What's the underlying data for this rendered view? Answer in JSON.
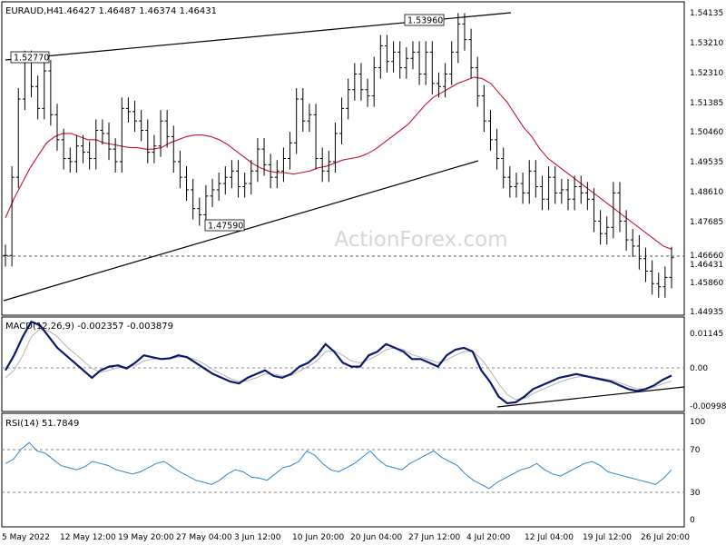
{
  "header": {
    "symbol": "EURAUD,H4",
    "ohlc": "1.46427 1.46487 1.46374 1.46431"
  },
  "watermark": "ActionForex.com",
  "colors": {
    "candles": "#000000",
    "sma": "#c8102e",
    "macd_line": "#0b1a6e",
    "macd_signal": "#b3b3b3",
    "rsi_line": "#2f86d0",
    "grid": "#9a9a9a",
    "watermark": "#d6d6d6"
  },
  "chart_data": [
    {
      "type": "candlestick",
      "title": "EURAUD,H4",
      "ohlc_label": "1.46427 1.46487 1.46374 1.46431",
      "y_ticks": [
        "1.54135",
        "1.53210",
        "1.52310",
        "1.51385",
        "1.50460",
        "1.49535",
        "1.48610",
        "1.47685",
        "1.46660",
        "1.46431",
        "1.45860",
        "1.44935"
      ],
      "current_price": 1.46431,
      "reference_level": 1.4666,
      "ylim": [
        1.4465,
        1.5455
      ],
      "x_labels": [
        "5 May 2022",
        "12 May 12:00",
        "19 May 20:00",
        "27 May 04:00",
        "3 Jun 12:00",
        "10 Jun 20:00",
        "20 Jun 04:00",
        "27 Jun 12:00",
        "4 Jul 20:00",
        "12 Jul 04:00",
        "19 Jul 12:00",
        "26 Jul 20:00"
      ],
      "annotations": [
        {
          "text": "1.52770",
          "value": 1.5277
        },
        {
          "text": "1.47590",
          "value": 1.4759
        },
        {
          "text": "1.53960",
          "value": 1.5396
        }
      ],
      "closes": [
        1.465,
        1.49,
        1.515,
        1.527,
        1.519,
        1.512,
        1.524,
        1.51,
        1.502,
        1.496,
        1.495,
        1.5,
        1.498,
        1.496,
        1.505,
        1.504,
        1.499,
        1.495,
        1.512,
        1.511,
        1.508,
        1.505,
        1.498,
        1.5,
        1.508,
        1.503,
        1.495,
        1.49,
        1.486,
        1.48,
        1.478,
        1.484,
        1.486,
        1.488,
        1.49,
        1.492,
        1.487,
        1.488,
        1.492,
        1.499,
        1.494,
        1.49,
        1.492,
        1.496,
        1.501,
        1.515,
        1.508,
        1.51,
        1.496,
        1.492,
        1.495,
        1.504,
        1.512,
        1.518,
        1.523,
        1.518,
        1.516,
        1.525,
        1.532,
        1.527,
        1.53,
        1.525,
        1.528,
        1.53,
        1.523,
        1.53,
        1.52,
        1.519,
        1.523,
        1.53,
        1.539,
        1.534,
        1.525,
        1.516,
        1.508,
        1.502,
        1.496,
        1.49,
        1.487,
        1.488,
        1.485,
        1.492,
        1.487,
        1.483,
        1.49,
        1.485,
        1.486,
        1.483,
        1.487,
        1.485,
        1.483,
        1.476,
        1.472,
        1.474,
        1.485,
        1.476,
        1.47,
        1.468,
        1.464,
        1.46,
        1.456,
        1.455,
        1.458,
        1.4643
      ],
      "sma": [
        1.477,
        1.483,
        1.488,
        1.493,
        1.497,
        1.501,
        1.503,
        1.504,
        1.504,
        1.503,
        1.502,
        1.502,
        1.501,
        1.5005,
        1.5,
        1.4995,
        1.4995,
        1.499,
        1.499,
        1.4995,
        1.501,
        1.502,
        1.503,
        1.5035,
        1.5035,
        1.503,
        1.502,
        1.5005,
        1.4985,
        1.4965,
        1.4945,
        1.493,
        1.492,
        1.4915,
        1.4915,
        1.491,
        1.4915,
        1.492,
        1.493,
        1.4935,
        1.4945,
        1.4955,
        1.496,
        1.4965,
        1.4975,
        1.499,
        1.501,
        1.503,
        1.505,
        1.507,
        1.51,
        1.513,
        1.5155,
        1.517,
        1.5185,
        1.52,
        1.521,
        1.522,
        1.5215,
        1.52,
        1.517,
        1.514,
        1.51,
        1.506,
        1.503,
        1.499,
        1.496,
        1.494,
        1.492,
        1.49,
        1.488,
        1.486,
        1.484,
        1.482,
        1.48,
        1.478,
        1.476,
        1.474,
        1.472,
        1.47,
        1.468,
        1.467
      ]
    },
    {
      "type": "line",
      "title": "MACD(12,26,9) -0.002357 -0.003879",
      "y_ticks": [
        "0.01145",
        "0.00",
        "-0.009985"
      ],
      "ylim": [
        -0.0115,
        0.0125
      ],
      "series": [
        {
          "name": "MACD",
          "values": [
            -0.001,
            0.003,
            0.008,
            0.012,
            0.011,
            0.008,
            0.005,
            0.003,
            0.001,
            -0.001,
            -0.003,
            -0.001,
            0.0,
            0.0003,
            -0.0005,
            0.001,
            0.003,
            0.0025,
            0.002,
            0.0022,
            0.003,
            0.0025,
            0.001,
            -0.0005,
            -0.002,
            -0.003,
            -0.004,
            -0.0045,
            -0.003,
            -0.002,
            -0.001,
            -0.0025,
            -0.003,
            -0.002,
            0.0,
            0.001,
            0.003,
            0.006,
            0.004,
            0.001,
            0.0,
            0.0,
            0.003,
            0.004,
            0.006,
            0.005,
            0.004,
            0.002,
            0.002,
            0.001,
            0.0,
            0.003,
            0.0045,
            0.005,
            0.004,
            -0.001,
            -0.004,
            -0.008,
            -0.0098,
            -0.0095,
            -0.008,
            -0.006,
            -0.005,
            -0.004,
            -0.003,
            -0.0025,
            -0.002,
            -0.0025,
            -0.003,
            -0.0035,
            -0.004,
            -0.005,
            -0.006,
            -0.0065,
            -0.006,
            -0.005,
            -0.0035,
            -0.0024
          ]
        },
        {
          "name": "Signal",
          "values": [
            -0.003,
            -0.001,
            0.003,
            0.008,
            0.01,
            0.0095,
            0.008,
            0.0055,
            0.0035,
            0.0015,
            -0.0005,
            -0.0015,
            -0.001,
            -0.0003,
            -0.0001,
            0.0002,
            0.0015,
            0.002,
            0.0022,
            0.0021,
            0.0025,
            0.0026,
            0.0018,
            0.0007,
            -0.0008,
            -0.002,
            -0.0032,
            -0.004,
            -0.0038,
            -0.003,
            -0.002,
            -0.002,
            -0.0025,
            -0.0024,
            -0.0012,
            0.0,
            0.0015,
            0.004,
            0.0042,
            0.003,
            0.0015,
            0.001,
            0.0018,
            0.003,
            0.0045,
            0.005,
            0.0045,
            0.0032,
            0.0025,
            0.0018,
            0.001,
            0.0018,
            0.003,
            0.004,
            0.0041,
            0.002,
            -0.001,
            -0.0045,
            -0.0075,
            -0.0088,
            -0.0085,
            -0.0072,
            -0.0062,
            -0.0052,
            -0.0042,
            -0.0034,
            -0.0028,
            -0.0026,
            -0.0028,
            -0.0032,
            -0.0036,
            -0.0043,
            -0.0052,
            -0.0059,
            -0.006,
            -0.0055,
            -0.0046,
            -0.0039
          ]
        }
      ]
    },
    {
      "type": "line",
      "title": "RSI(14) 51.7849",
      "y_ticks": [
        "100",
        "70",
        "30",
        "0"
      ],
      "ylim": [
        0,
        100
      ],
      "series": [
        {
          "name": "RSI(14)",
          "values": [
            58,
            62,
            72,
            78,
            70,
            68,
            62,
            56,
            54,
            52,
            55,
            60,
            58,
            56,
            52,
            50,
            48,
            50,
            54,
            58,
            60,
            55,
            50,
            46,
            42,
            40,
            38,
            42,
            48,
            52,
            50,
            45,
            44,
            42,
            48,
            54,
            56,
            60,
            70,
            66,
            58,
            52,
            50,
            54,
            58,
            64,
            70,
            62,
            56,
            54,
            52,
            58,
            62,
            66,
            70,
            64,
            60,
            56,
            48,
            42,
            38,
            34,
            40,
            44,
            48,
            52,
            54,
            58,
            52,
            48,
            46,
            50,
            54,
            58,
            60,
            56,
            50,
            48,
            46,
            44,
            42,
            40,
            38,
            44,
            52
          ]
        }
      ]
    }
  ]
}
